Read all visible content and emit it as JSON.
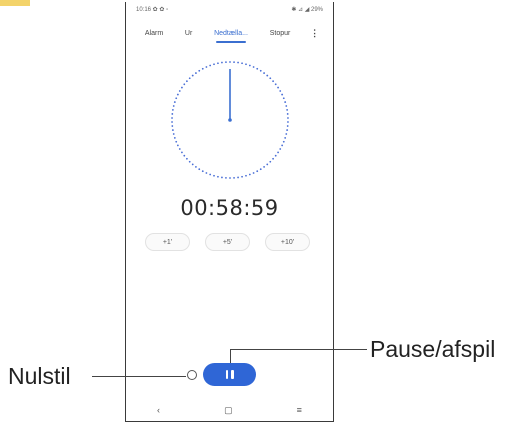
{
  "status_bar": {
    "left": "10:16 ✿ ✿ ▫",
    "right": "✱ ⊿ ◢ 29%"
  },
  "tabs": [
    {
      "label": "Alarm",
      "active": false
    },
    {
      "label": "Ur",
      "active": false
    },
    {
      "label": "Nedtælla...",
      "active": true
    },
    {
      "label": "Stopur",
      "active": false
    }
  ],
  "menu_icon": "⋮",
  "timer": {
    "display": "00:58:59",
    "remaining_fraction": 0.98
  },
  "add_time_chips": [
    "+1'",
    "+5'",
    "+10'"
  ],
  "controls": {
    "reset_icon": "reset-icon",
    "pause_icon": "pause-icon"
  },
  "nav_bar": {
    "back": "‹",
    "home": "▢",
    "recents": "≡"
  },
  "callouts": {
    "reset": "Nulstil",
    "pause": "Pause/afspil"
  },
  "colors": {
    "accent": "#2f66d6",
    "tab_active": "#3b6fd0",
    "dial_dots": "#4a6fd6"
  }
}
